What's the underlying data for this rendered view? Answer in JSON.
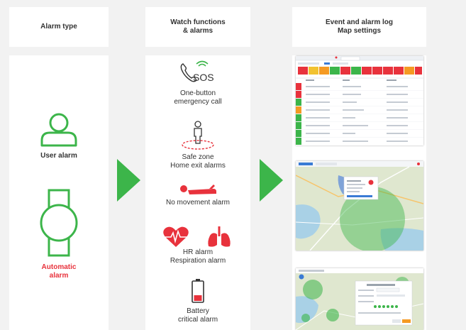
{
  "headers": {
    "alarm_type": "Alarm type",
    "watch_functions_line1": "Watch functions",
    "watch_functions_line2": "& alarms",
    "event_log_line1": "Event and alarm log",
    "event_log_line2": "Map settings"
  },
  "alarm_types": {
    "user_alarm": "User alarm",
    "automatic_alarm_line1": "Automatic",
    "automatic_alarm_line2": "alarm"
  },
  "functions": {
    "sos_icon_text": "SOS",
    "sos_line1": "One-button",
    "sos_line2": "emergency call",
    "safezone_line1": "Safe zone",
    "safezone_line2": "Home exit alarms",
    "nomovement": "No movement alarm",
    "hr_line1": "HR alarm",
    "hr_line2": "Respiration alarm",
    "battery_line1": "Battery",
    "battery_line2": "critical alarm"
  },
  "colors": {
    "green": "#3cb54a",
    "red": "#e8323c",
    "panel": "#ffffff",
    "background": "#f2f2f2"
  },
  "icons": {
    "user": "person-outline-icon",
    "watch": "watch-outline-icon",
    "sos": "phone-sos-icon",
    "safezone": "person-zone-icon",
    "nomovement": "person-lying-icon",
    "hr": "heart-pulse-icon",
    "respiration": "lungs-icon",
    "battery": "battery-low-icon",
    "arrow": "chevron-arrow-icon"
  }
}
